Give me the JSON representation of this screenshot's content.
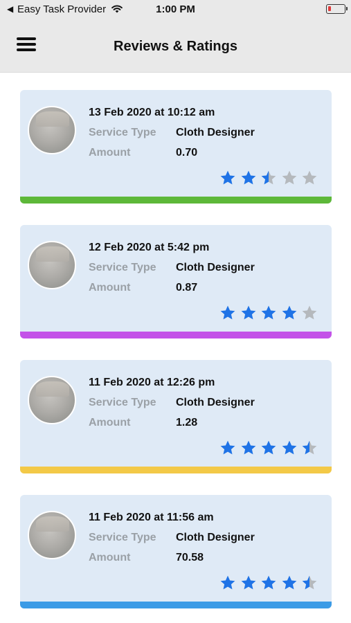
{
  "status_bar": {
    "back_glyph": "◀",
    "carrier": "Easy Task Provider",
    "time": "1:00 PM",
    "wifi_icon": "wifi-icon",
    "battery_icon": "battery-icon"
  },
  "header": {
    "title": "Reviews & Ratings",
    "menu_icon": "hamburger-menu-icon"
  },
  "labels": {
    "service_type": "Service Type",
    "amount": "Amount"
  },
  "colors": {
    "star_filled": "#1f73e6",
    "star_empty": "#b5b9bd"
  },
  "reviews": [
    {
      "date": "13 Feb 2020 at 10:12 am",
      "service_type": "Cloth Designer",
      "amount": "0.70",
      "rating": 2.5,
      "strip_color": "#5db839"
    },
    {
      "date": "12 Feb 2020 at 5:42 pm",
      "service_type": "Cloth Designer",
      "amount": "0.87",
      "rating": 4,
      "strip_color": "#c352e8"
    },
    {
      "date": "11 Feb 2020 at 12:26 pm",
      "service_type": "Cloth Designer",
      "amount": "1.28",
      "rating": 4.5,
      "strip_color": "#f3c947"
    },
    {
      "date": "11 Feb 2020 at 11:56 am",
      "service_type": "Cloth Designer",
      "amount": "70.58",
      "rating": 4.5,
      "strip_color": "#3b9be6"
    }
  ]
}
